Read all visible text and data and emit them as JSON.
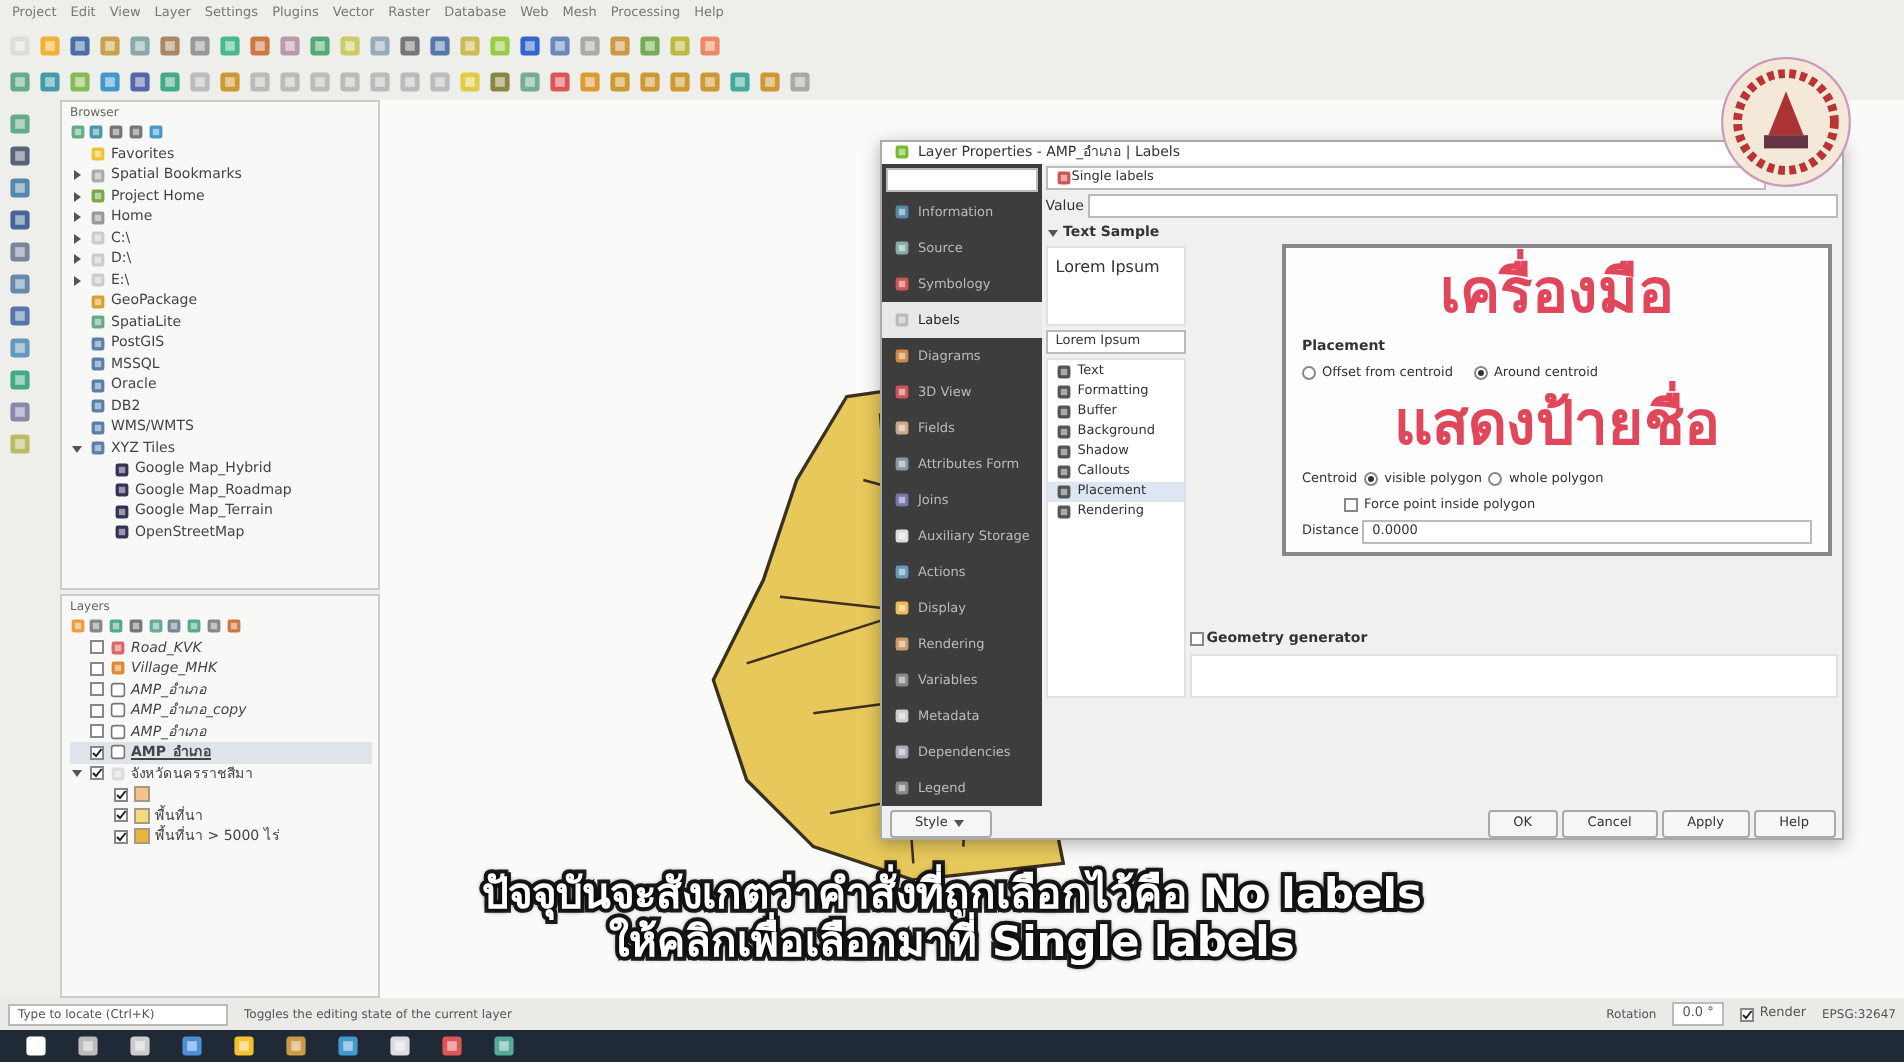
{
  "menu": [
    "Project",
    "Edit",
    "View",
    "Layer",
    "Settings",
    "Plugins",
    "Vector",
    "Raster",
    "Database",
    "Web",
    "Mesh",
    "Processing",
    "Help"
  ],
  "browser": {
    "title": "Browser",
    "items": [
      {
        "label": "Favorites"
      },
      {
        "label": "Spatial Bookmarks",
        "expanded": false
      },
      {
        "label": "Project Home",
        "expanded": false
      },
      {
        "label": "Home",
        "expanded": false
      },
      {
        "label": "C:\\",
        "expanded": false
      },
      {
        "label": "D:\\",
        "expanded": false
      },
      {
        "label": "E:\\",
        "expanded": false
      },
      {
        "label": "GeoPackage"
      },
      {
        "label": "SpatiaLite"
      },
      {
        "label": "PostGIS"
      },
      {
        "label": "MSSQL"
      },
      {
        "label": "Oracle"
      },
      {
        "label": "DB2"
      },
      {
        "label": "WMS/WMTS"
      },
      {
        "label": "XYZ Tiles",
        "expanded": true,
        "children": [
          {
            "label": "Google Map_Hybrid"
          },
          {
            "label": "Google Map_Roadmap"
          },
          {
            "label": "Google Map_Terrain"
          },
          {
            "label": "OpenStreetMap"
          }
        ]
      }
    ]
  },
  "layers": {
    "title": "Layers",
    "items": [
      {
        "label": "Road_KVK",
        "checked": false,
        "kind": "line"
      },
      {
        "label": "Village_MHK",
        "checked": false,
        "kind": "point"
      },
      {
        "label": "AMP_อำเภอ",
        "checked": false,
        "kind": "polygon"
      },
      {
        "label": "AMP_อำเภอ_copy",
        "checked": false,
        "kind": "polygon"
      },
      {
        "label": "AMP_อำเภอ",
        "checked": false,
        "kind": "polygon"
      },
      {
        "label": "AMP_อำเภอ",
        "checked": true,
        "kind": "polygon",
        "selected": true
      },
      {
        "label": "จังหวัดนครราชสีมา",
        "checked": true,
        "kind": "group",
        "children": [
          {
            "checked": true,
            "kind": "swatch",
            "color": "#f2c38a"
          },
          {
            "label": "พื้นที่นา",
            "checked": true,
            "kind": "swatch",
            "color": "#f0dc7a"
          },
          {
            "label": "พื้นที่นา > 5000 ไร่",
            "checked": true,
            "kind": "swatch",
            "color": "#e8b83c"
          }
        ]
      }
    ]
  },
  "dialog": {
    "title": "Layer Properties - AMP_อำเภอ | Labels",
    "nav": [
      {
        "label": "Information",
        "selected": false
      },
      {
        "label": "Source",
        "selected": false
      },
      {
        "label": "Symbology",
        "selected": false
      },
      {
        "label": "Labels",
        "selected": true
      },
      {
        "label": "Diagrams",
        "selected": false
      },
      {
        "label": "3D View",
        "selected": false
      },
      {
        "label": "Fields",
        "selected": false
      },
      {
        "label": "Attributes Form",
        "selected": false
      },
      {
        "label": "Joins",
        "selected": false
      },
      {
        "label": "Auxiliary Storage",
        "selected": false
      },
      {
        "label": "Actions",
        "selected": false
      },
      {
        "label": "Display",
        "selected": false
      },
      {
        "label": "Rendering",
        "selected": false
      },
      {
        "label": "Variables",
        "selected": false
      },
      {
        "label": "Metadata",
        "selected": false
      },
      {
        "label": "Dependencies",
        "selected": false
      },
      {
        "label": "Legend",
        "selected": false
      }
    ],
    "mode": "Single labels",
    "value_label": "Value",
    "section": "Text Sample",
    "sample": "Lorem Ipsum",
    "sample_field": "Lorem Ipsum",
    "tabs": [
      {
        "label": "Text",
        "selected": false
      },
      {
        "label": "Formatting",
        "selected": false
      },
      {
        "label": "Buffer",
        "selected": false
      },
      {
        "label": "Background",
        "selected": false
      },
      {
        "label": "Shadow",
        "selected": false
      },
      {
        "label": "Callouts",
        "selected": false
      },
      {
        "label": "Placement",
        "selected": true
      },
      {
        "label": "Rendering",
        "selected": false
      }
    ],
    "overlay": [
      "เครื่องมือ",
      "แสดงป้ายชื่อ"
    ],
    "placement_title": "Placement",
    "placement_options": [
      {
        "label": "Offset from centroid",
        "selected": false
      },
      {
        "label": "Around centroid",
        "selected": true
      }
    ],
    "centroid_label": "Centroid",
    "centroid_options": [
      {
        "label": "visible polygon",
        "selected": true
      },
      {
        "label": "whole polygon",
        "selected": false
      }
    ],
    "force_point": {
      "label": "Force point inside polygon",
      "checked": false
    },
    "distance_label": "Distance",
    "distance_value": "0.0000",
    "geometry_generator": "Geometry generator",
    "geometry_checked": false,
    "style": "Style",
    "buttons": [
      "OK",
      "Cancel",
      "Apply",
      "Help"
    ]
  },
  "status": {
    "locator": "Type to locate (Ctrl+K)",
    "message": "Toggles the editing state of the current layer",
    "rotation_label": "Rotation",
    "rotation": "0.0 °",
    "render": "Render",
    "render_checked": true,
    "crs": "EPSG:32647"
  },
  "captions": [
    "ปัจจุบันจะสังเกตว่าคำสั่งที่ถูกเลือกไว้คือ No labels",
    "ให้คลิกเพื่อเลือกมาที่ Single labels"
  ]
}
